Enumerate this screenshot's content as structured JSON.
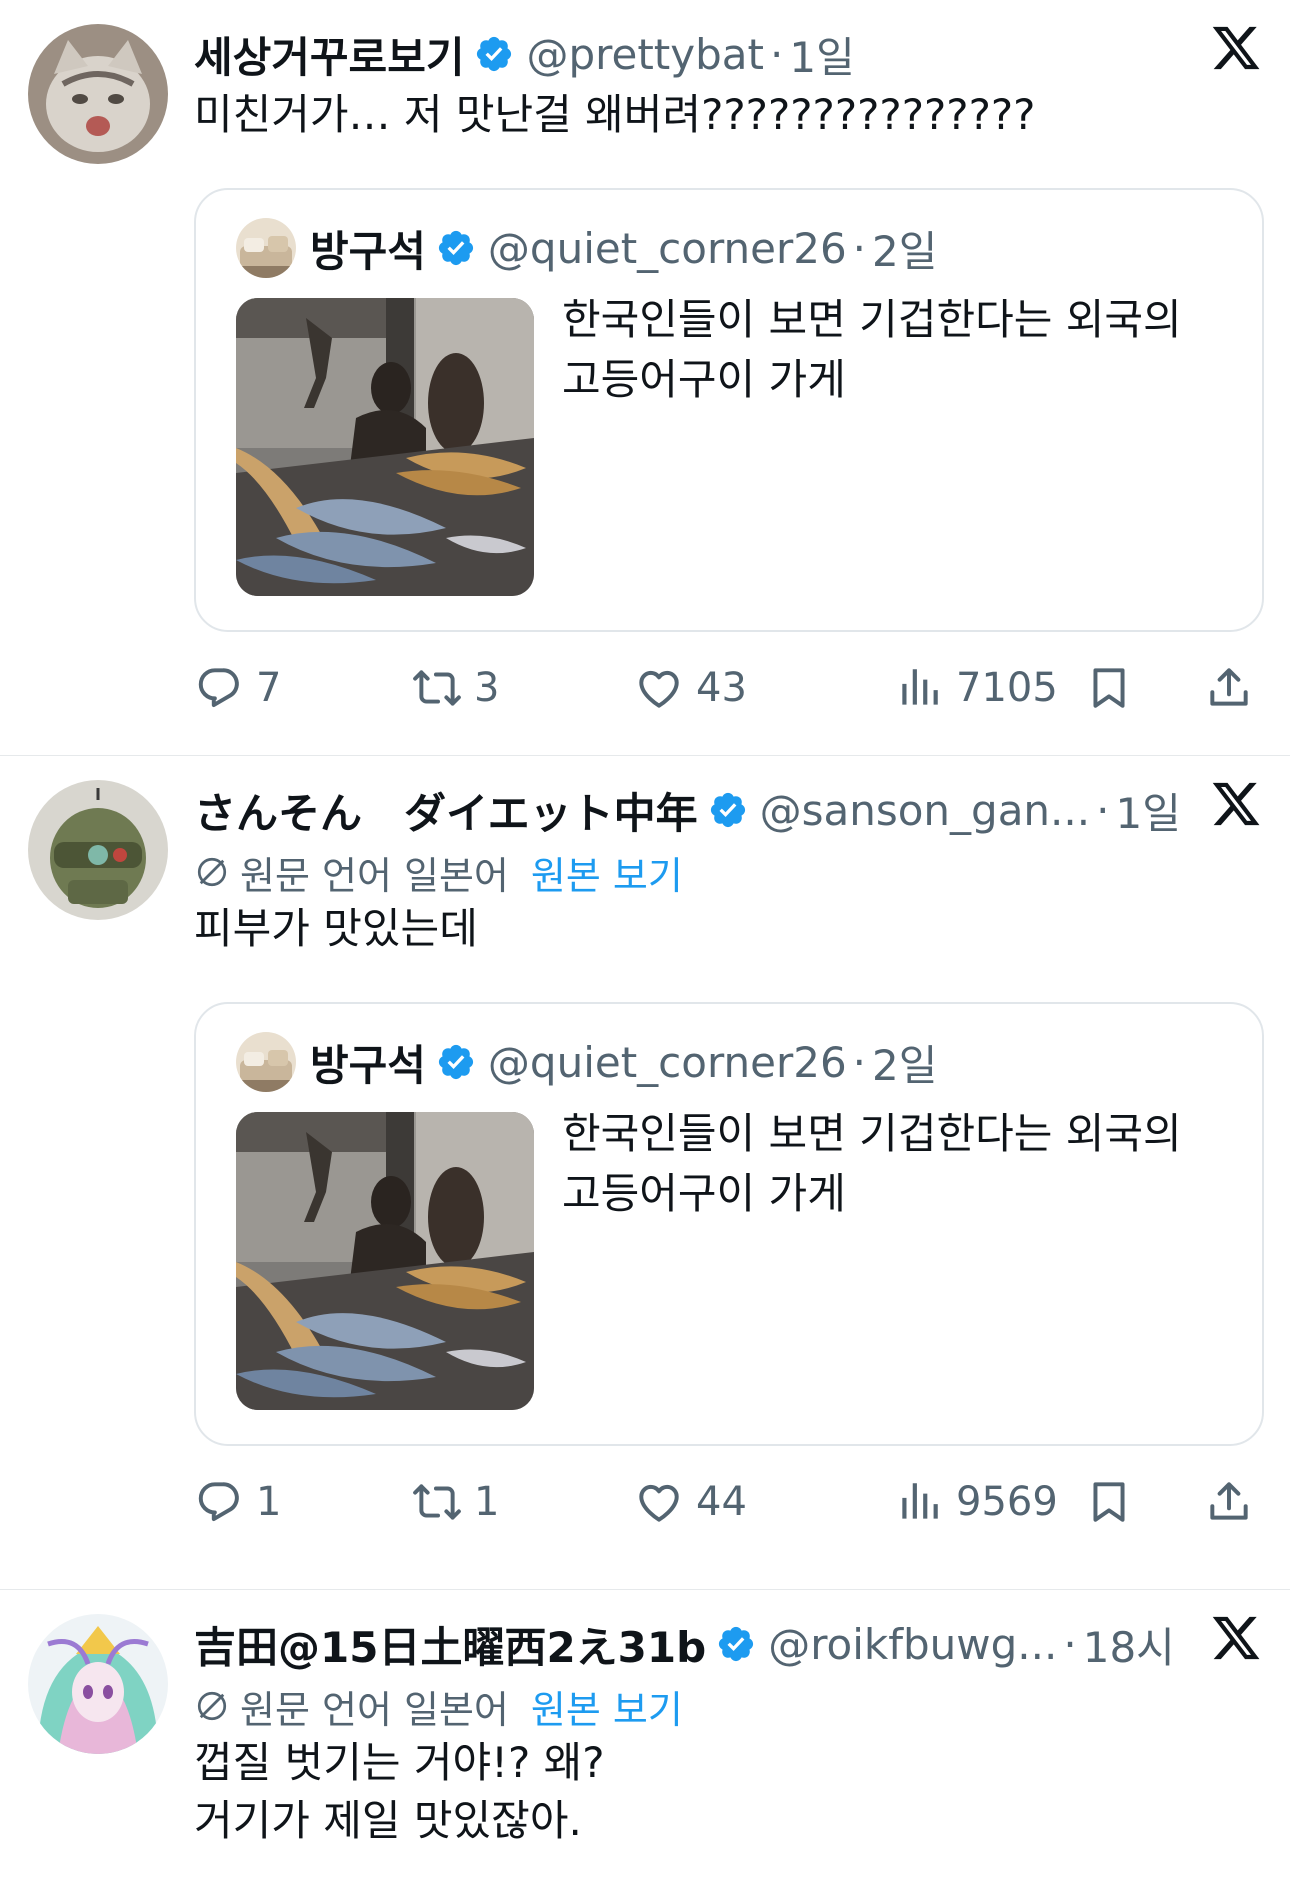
{
  "colors": {
    "verified": "#1d9bf0",
    "link": "#1d9bf0",
    "muted": "#536471",
    "text": "#0f1419"
  },
  "icons": {
    "verified": "verified-badge-icon",
    "x": "x-logo-icon",
    "reply": "reply-icon",
    "retweet": "retweet-icon",
    "like": "heart-icon",
    "views": "views-icon",
    "bookmark": "bookmark-icon",
    "share": "share-icon",
    "translate": "translate-icon"
  },
  "tweets": [
    {
      "name": "세상거꾸로보기",
      "handle": "@prettybat",
      "time": "1일",
      "text": "미친거가… 저 맛난걸 왜버려???????????????",
      "quote": {
        "name": "방구석",
        "handle": "@quiet_corner26",
        "time": "2일",
        "text": "한국인들이 보면 기겁한다는 외국의 고등어구이 가게"
      },
      "stats": {
        "replies": "7",
        "retweets": "3",
        "likes": "43",
        "views": "7105"
      }
    },
    {
      "name": "さんそん　ダイエット中年",
      "handle": "@sanson_gan...",
      "time": "1일",
      "translation": {
        "label": "원문 언어 일본어",
        "link": "원본 보기"
      },
      "text": "피부가 맛있는데",
      "quote": {
        "name": "방구석",
        "handle": "@quiet_corner26",
        "time": "2일",
        "text": "한국인들이 보면 기겁한다는 외국의 고등어구이 가게"
      },
      "stats": {
        "replies": "1",
        "retweets": "1",
        "likes": "44",
        "views": "9569"
      }
    },
    {
      "name": "吉田@15日土曜西2え31b",
      "handle": "@roikfbuwg...",
      "time": "18시",
      "translation": {
        "label": "원문 언어 일본어",
        "link": "원본 보기"
      },
      "text_lines": [
        "껍질 벗기는 거야!? 왜?",
        "거기가 제일 맛있잖아."
      ]
    }
  ]
}
